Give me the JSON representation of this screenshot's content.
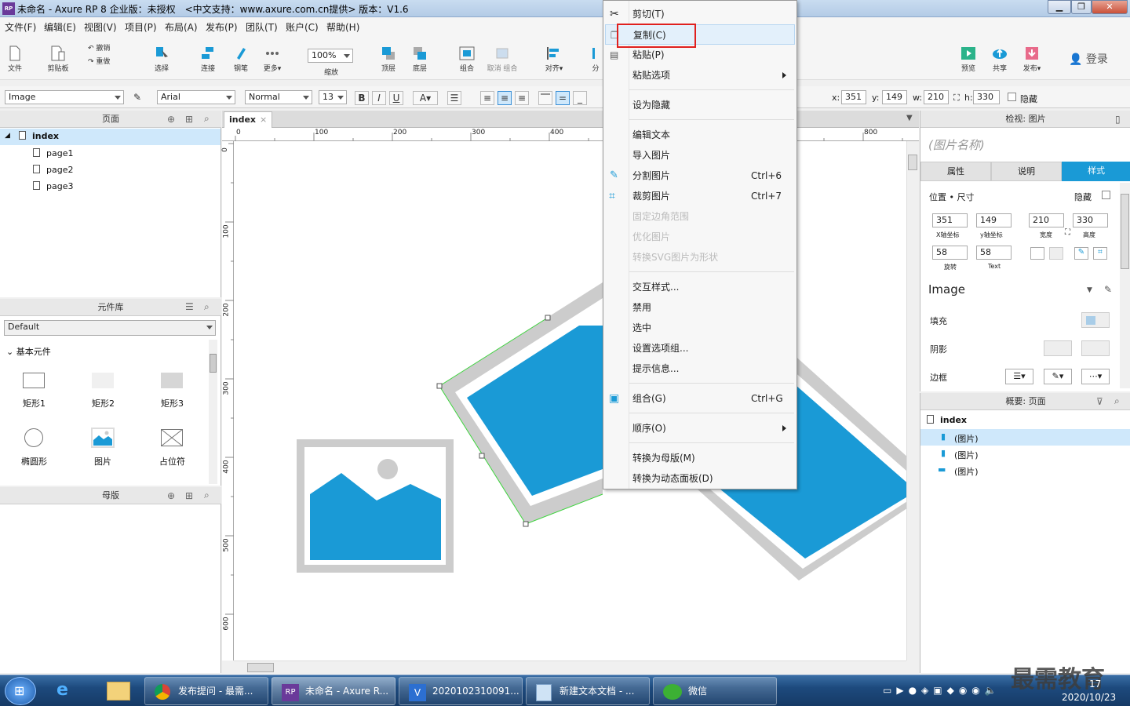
{
  "window": {
    "title": "未命名 - Axure RP 8 企业版：未授权　<中文支持：www.axure.com.cn提供> 版本：V1.6",
    "logo": "RP"
  },
  "menubar": [
    "文件(F)",
    "编辑(E)",
    "视图(V)",
    "项目(P)",
    "布局(A)",
    "发布(P)",
    "团队(T)",
    "账户(C)",
    "帮助(H)"
  ],
  "toolbar": {
    "file": "文件",
    "clipboard": "剪贴板",
    "undo": "撤销",
    "redo": "重做",
    "select": "选择",
    "connect": "连接",
    "pen": "钢笔",
    "more": "更多▾",
    "zoom_value": "100%",
    "zoom_label": "缩放",
    "top": "顶层",
    "bottom": "底层",
    "group": "组合",
    "ungroup": "取消 组合",
    "align": "对齐▾",
    "distribute": "分",
    "preview": "预览",
    "share": "共享",
    "publish": "发布▾",
    "login": "登录"
  },
  "format": {
    "style": "Image",
    "font": "Arial",
    "weight": "Normal",
    "size": "13",
    "x_label": "x:",
    "x": "351",
    "y_label": "y:",
    "y": "149",
    "w_label": "w:",
    "w": "210",
    "h_label": "h:",
    "h": "330",
    "hide_label": "隐藏"
  },
  "pages_panel": {
    "title": "页面",
    "root": "index",
    "pages": [
      "page1",
      "page2",
      "page3"
    ]
  },
  "library_panel": {
    "title": "元件库",
    "selected": "Default",
    "group": "基本元件",
    "items": [
      "矩形1",
      "矩形2",
      "矩形3",
      "椭圆形",
      "图片",
      "占位符"
    ]
  },
  "masters_panel": {
    "title": "母版"
  },
  "canvas": {
    "tab": "index",
    "ruler_h": [
      "0",
      "100",
      "200",
      "300",
      "400",
      "800"
    ],
    "ruler_v": [
      "0",
      "100",
      "200",
      "300",
      "400",
      "500",
      "600"
    ]
  },
  "context_menu": {
    "items": [
      {
        "label": "剪切(T)",
        "shortcut": ""
      },
      {
        "label": "复制(C)",
        "shortcut": ""
      },
      {
        "label": "粘贴(P)",
        "shortcut": ""
      },
      {
        "label": "粘贴选项",
        "shortcut": ""
      },
      {
        "label": "设为隐藏",
        "shortcut": ""
      },
      {
        "label": "编辑文本",
        "shortcut": ""
      },
      {
        "label": "导入图片",
        "shortcut": ""
      },
      {
        "label": "分割图片",
        "shortcut": "Ctrl+6"
      },
      {
        "label": "裁剪图片",
        "shortcut": "Ctrl+7"
      },
      {
        "label": "固定边角范围",
        "shortcut": ""
      },
      {
        "label": "优化图片",
        "shortcut": ""
      },
      {
        "label": "转换SVG图片为形状",
        "shortcut": ""
      },
      {
        "label": "交互样式...",
        "shortcut": ""
      },
      {
        "label": "禁用",
        "shortcut": ""
      },
      {
        "label": "选中",
        "shortcut": ""
      },
      {
        "label": "设置选项组...",
        "shortcut": ""
      },
      {
        "label": "提示信息...",
        "shortcut": ""
      },
      {
        "label": "组合(G)",
        "shortcut": "Ctrl+G"
      },
      {
        "label": "顺序(O)",
        "shortcut": ""
      },
      {
        "label": "转换为母版(M)",
        "shortcut": ""
      },
      {
        "label": "转换为动态面板(D)",
        "shortcut": ""
      }
    ]
  },
  "inspector": {
    "title": "检视: 图片",
    "name_placeholder": "(图片名称)",
    "tabs": [
      "属性",
      "说明",
      "样式"
    ],
    "pos_size": "位置 • 尺寸",
    "hide": "隐藏",
    "x": "351",
    "y": "149",
    "w": "210",
    "h": "330",
    "x_label": "X轴坐标",
    "y_label": "y轴坐标",
    "w_label": "宽度",
    "h_label": "高度",
    "rotate": "58",
    "text_rotate": "58",
    "rotate_label": "旋转",
    "text_label": "Text",
    "style": "Image",
    "fill": "填充",
    "shadow": "阴影",
    "border": "边框"
  },
  "outline": {
    "title": "概要: 页面",
    "root": "index",
    "items": [
      "(图片)",
      "(图片)",
      "(图片)"
    ]
  },
  "taskbar": {
    "tasks": [
      "发布提问 - 最需...",
      "未命名 - Axure R...",
      "2020102310091...",
      "新建文本文档 - ...",
      "微信"
    ],
    "time": "17",
    "date": "2020/10/23",
    "watermark": "最需教育"
  },
  "colors": {
    "accent": "#1a9ad6",
    "highlight": "#cfe8fb",
    "selection_outline": "#e0201e"
  }
}
